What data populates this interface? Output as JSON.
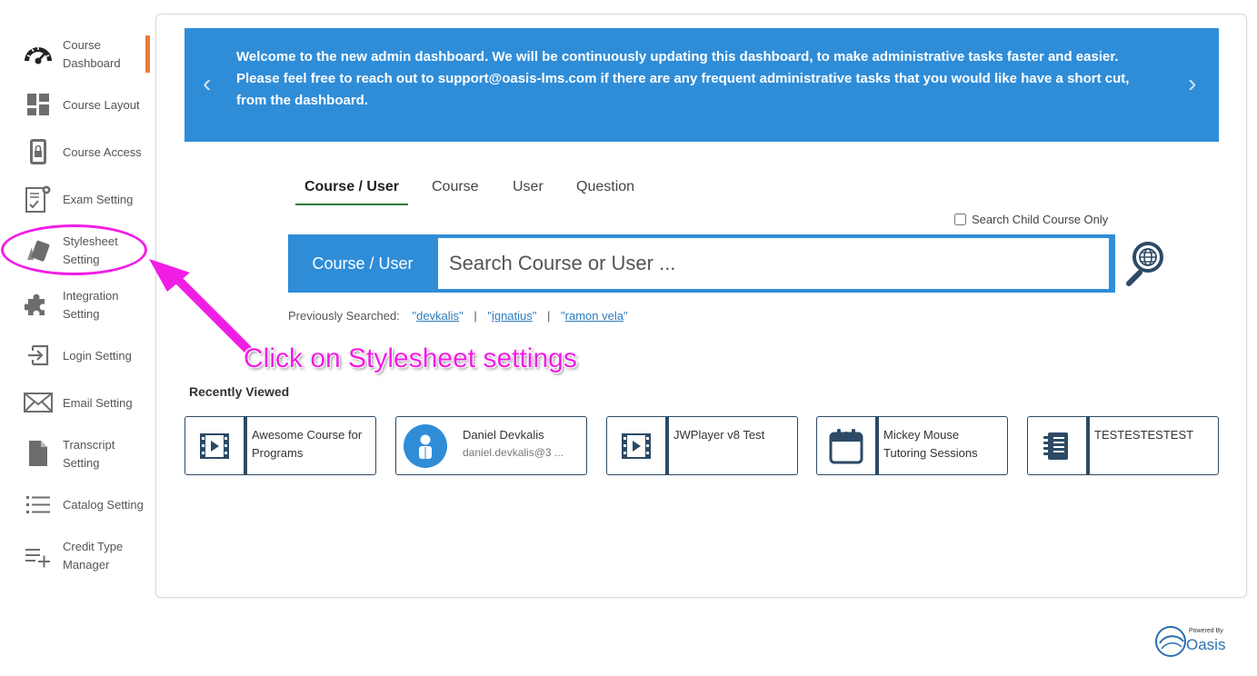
{
  "sidebar": {
    "items": [
      {
        "label": "Course Dashboard",
        "icon": "dashboard-gauge-icon"
      },
      {
        "label": "Course Layout",
        "icon": "layout-icon"
      },
      {
        "label": "Course Access",
        "icon": "lock-icon"
      },
      {
        "label": "Exam Setting",
        "icon": "exam-icon"
      },
      {
        "label": "Stylesheet Setting",
        "icon": "stylesheet-icon"
      },
      {
        "label": "Integration Setting",
        "icon": "puzzle-icon"
      },
      {
        "label": "Login Setting",
        "icon": "login-icon"
      },
      {
        "label": "Email Setting",
        "icon": "envelope-icon"
      },
      {
        "label": "Transcript Setting",
        "icon": "document-icon"
      },
      {
        "label": "Catalog Setting",
        "icon": "list-icon"
      },
      {
        "label": "Credit Type Manager",
        "icon": "add-list-icon"
      }
    ]
  },
  "banner": {
    "text": "Welcome to the new admin dashboard. We will be continuously updating this dashboard, to make administrative tasks faster and easier. Please feel free to reach out to support@oasis-lms.com if there are any frequent administrative tasks that you would like have a short cut, from the dashboard.",
    "prev_glyph": "‹",
    "next_glyph": "›"
  },
  "tabs": [
    {
      "label": "Course / User",
      "active": true
    },
    {
      "label": "Course",
      "active": false
    },
    {
      "label": "User",
      "active": false
    },
    {
      "label": "Question",
      "active": false
    }
  ],
  "search": {
    "child_only_label": "Search Child Course Only",
    "type_label": "Course / User",
    "placeholder": "Search Course or User ..."
  },
  "previous": {
    "label": "Previously Searched:",
    "terms": [
      "devkalis",
      "ignatius",
      "ramon vela"
    ]
  },
  "annotation": {
    "text": "Click on Stylesheet settings"
  },
  "recent": {
    "title": "Recently Viewed",
    "cards": [
      {
        "title": "Awesome Course for Programs",
        "sub": "",
        "icon": "video-icon"
      },
      {
        "title": "Daniel Devkalis",
        "sub": "daniel.devkalis@3 ...",
        "icon": "user-avatar-icon"
      },
      {
        "title": "JWPlayer v8 Test",
        "sub": "",
        "icon": "video-icon"
      },
      {
        "title": "Mickey Mouse Tutoring Sessions",
        "sub": "",
        "icon": "calendar-icon"
      },
      {
        "title": "TESTESTESTEST",
        "sub": "",
        "icon": "book-icon"
      }
    ]
  },
  "footer": {
    "powered_by": "Powered By",
    "brand": "Oasis"
  },
  "colors": {
    "accent_blue": "#2f8dd8",
    "navy": "#2c4a66",
    "annotation_magenta": "#f21de5",
    "active_indicator": "#ee7a3a",
    "tab_underline": "#2f7a3b"
  }
}
